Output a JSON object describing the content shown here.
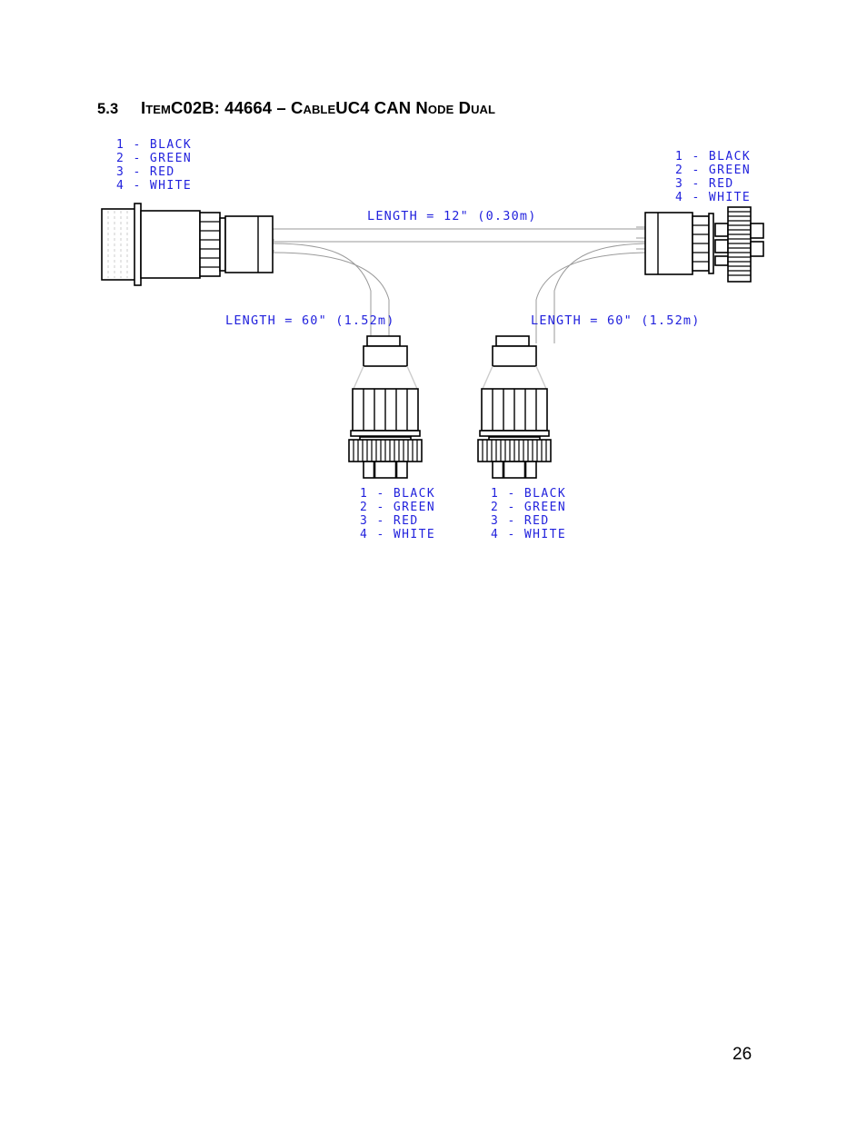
{
  "document": {
    "section_number": "5.3",
    "section_title_parts": {
      "item": "Item",
      "code": "C02B: 44664 – ",
      "cable": "Cable",
      "product": "UC4 CAN ",
      "node": "Node",
      "dual": "Dual"
    },
    "section_title_full": "5.3  Item C02B: 44664 – Cable UC4 CAN Node Dual",
    "page_number": "26"
  },
  "diagram": {
    "name": "cable-assembly-drawing",
    "line_color": "#000000",
    "label_color": "#2222dd",
    "wire_color": "#999999",
    "pin_legends": [
      {
        "id": "legend-top-left",
        "rows": [
          "1 - BLACK",
          "2 - GREEN",
          "3 - RED",
          "4 - WHITE"
        ]
      },
      {
        "id": "legend-top-right",
        "rows": [
          "1 - BLACK",
          "2 - GREEN",
          "3 - RED",
          "4 - WHITE"
        ]
      },
      {
        "id": "legend-bottom-left",
        "rows": [
          "1 - BLACK",
          "2 - GREEN",
          "3 - RED",
          "4 - WHITE"
        ]
      },
      {
        "id": "legend-bottom-right",
        "rows": [
          "1 - BLACK",
          "2 - GREEN",
          "3 - RED",
          "4 - WHITE"
        ]
      }
    ],
    "length_labels": [
      {
        "id": "length-main",
        "text": "LENGTH = 12\" (0.30m)"
      },
      {
        "id": "length-branch-left",
        "text": "LENGTH = 60\" (1.52m)"
      },
      {
        "id": "length-branch-right",
        "text": "LENGTH = 60\" (1.52m)"
      }
    ],
    "connectors": [
      {
        "id": "connector-left-bulkhead",
        "orientation": "horizontal"
      },
      {
        "id": "connector-right-threaded",
        "orientation": "horizontal"
      },
      {
        "id": "connector-bottom-left",
        "orientation": "vertical"
      },
      {
        "id": "connector-bottom-right",
        "orientation": "vertical"
      }
    ]
  }
}
